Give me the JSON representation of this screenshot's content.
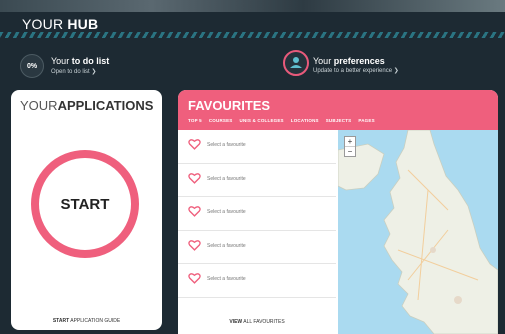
{
  "header": {
    "title_prefix": "YOUR",
    "title_bold": "HUB"
  },
  "todo": {
    "percent": "0%",
    "title_prefix": "Your",
    "title_bold": "to do list",
    "subtitle": "Open to do list ❯"
  },
  "preferences": {
    "title_prefix": "Your",
    "title_bold": "preferences",
    "subtitle": "Update to a better experience ❯"
  },
  "applications": {
    "title_prefix": "YOUR",
    "title_bold": "APPLICATIONS",
    "start_label": "START",
    "footer_bold": "START",
    "footer_text": "APPLICATION GUIDE"
  },
  "favourites": {
    "title": "FAVOURITES",
    "tabs": [
      "TOP 5",
      "COURSES",
      "UNIS & COLLEGES",
      "LOCATIONS",
      "SUBJECTS",
      "PAGES"
    ],
    "items": [
      {
        "label": "Select a favourite"
      },
      {
        "label": "Select a favourite"
      },
      {
        "label": "Select a favourite"
      },
      {
        "label": "Select a favourite"
      },
      {
        "label": "Select a favourite"
      }
    ],
    "footer_bold": "VIEW",
    "footer_text": "ALL FAVOURITES"
  },
  "map": {
    "zoom_in": "+",
    "zoom_out": "−"
  },
  "colors": {
    "accent": "#ef5f7d",
    "background": "#1d2a33",
    "stripe": "#2f8c9c",
    "water": "#aadaf0",
    "land": "#eef0e6"
  },
  "icons": [
    "user-icon",
    "heart-icon"
  ]
}
